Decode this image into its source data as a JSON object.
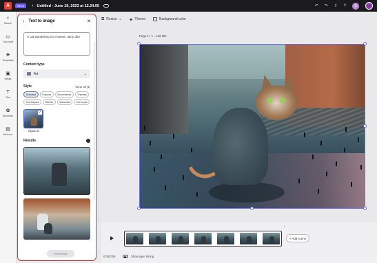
{
  "app": {
    "beta_badge": "BETA",
    "doc_title": "Untitled - June 19, 2023 at 12.24.05",
    "avatar_initial": "S"
  },
  "rail": [
    {
      "id": "search",
      "label": "Search",
      "icon": "⌕"
    },
    {
      "id": "your-stuff",
      "label": "Your stuff",
      "icon": "▭"
    },
    {
      "id": "templates",
      "label": "Templates",
      "icon": "❖"
    },
    {
      "id": "media",
      "label": "Media",
      "icon": "▣"
    },
    {
      "id": "text",
      "label": "Text",
      "icon": "T"
    },
    {
      "id": "elements",
      "label": "Elements",
      "icon": "✿"
    },
    {
      "id": "add-ons",
      "label": "Add-ons",
      "icon": "▤"
    }
  ],
  "panel": {
    "title": "Text to image",
    "prompt": "A cat wandering on a street, rainy day",
    "content_type_label": "Content type",
    "content_type_value": "Art",
    "style_label": "Style",
    "clear_all": "Clear all (1)",
    "chips": [
      {
        "label": "Selected",
        "active": true
      },
      {
        "label": "Popular",
        "active": false
      },
      {
        "label": "Movements",
        "active": false
      },
      {
        "label": "Themes",
        "active": false
      },
      {
        "label": "Techniques",
        "active": false
      },
      {
        "label": "Effects",
        "active": false
      },
      {
        "label": "Materials",
        "active": false
      },
      {
        "label": "Concepts",
        "active": false
      }
    ],
    "selected_style": "Digital art",
    "results_label": "Results",
    "generate_label": "Generate"
  },
  "toolbar": {
    "resize": "Resize",
    "theme": "Theme",
    "background_color": "Background color"
  },
  "canvas": {
    "page_label": "Page 1 / 1 - Add title"
  },
  "timeline": {
    "add_scene": "+ Add scene",
    "timecode": "0:00/0:05",
    "show_layer_timing": "Show layer timing"
  },
  "colors": {
    "accent_red": "#d5343f",
    "selection_blue": "#6b6cf0",
    "topbar": "#1b1b1f"
  }
}
